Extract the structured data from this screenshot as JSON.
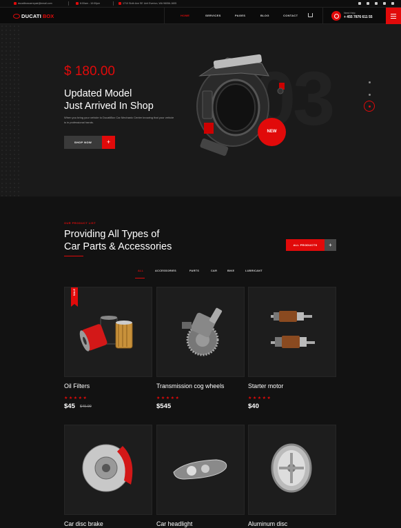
{
  "topbar": {
    "email": "ducatiboxcarrepair@email.com",
    "hours": "8:00am - 10:00pm",
    "address": "1710 Sixth Ave SE Unit Everton, WA 98056-1605"
  },
  "brand": {
    "part1": "DUCATI",
    "part2": "BOX"
  },
  "nav": {
    "items": [
      "HOME",
      "SERVICES",
      "PAGES",
      "BLOG",
      "CONTACT"
    ],
    "help_label": "Need Help",
    "help_phone": "+ 455 7876 611 55"
  },
  "hero": {
    "price": "$ 180.00",
    "title_line1": "Updated Model",
    "title_line2": "Just Arrived In Shop",
    "description": "When you bring your vehicle to DucatiBox Car Mechanic Center knowing that your vehicle is in professional hands.",
    "button": "SHOP NOW",
    "button_plus": "+",
    "badge": "NEW",
    "slide_number": "03"
  },
  "products": {
    "eyebrow": "OUR PRODUCT LIST",
    "title_line1": "Providing All Types of",
    "title_line2": "Car Parts & Accessories",
    "all_button": "ALL PRODUCTS",
    "all_plus": "+",
    "filters": [
      "ALL",
      "ACCESSORIES",
      "PARTS",
      "CAR",
      "BIKE",
      "LUBRICANT"
    ],
    "sale_label": "SALE",
    "items": [
      {
        "name": "Oil Filters",
        "price": "$45",
        "old_price": "$49.99",
        "rating": 5
      },
      {
        "name": "Transmission cog wheels",
        "price": "$545",
        "rating": 5
      },
      {
        "name": "Starter motor",
        "price": "$40",
        "rating": 5
      },
      {
        "name": "Car disc brake"
      },
      {
        "name": "Car headlight"
      },
      {
        "name": "Aluminum disc"
      }
    ],
    "stars": "★★★★★"
  },
  "colors": {
    "accent": "#e10a0a",
    "background": "#141414",
    "card": "#1d1d1d"
  }
}
